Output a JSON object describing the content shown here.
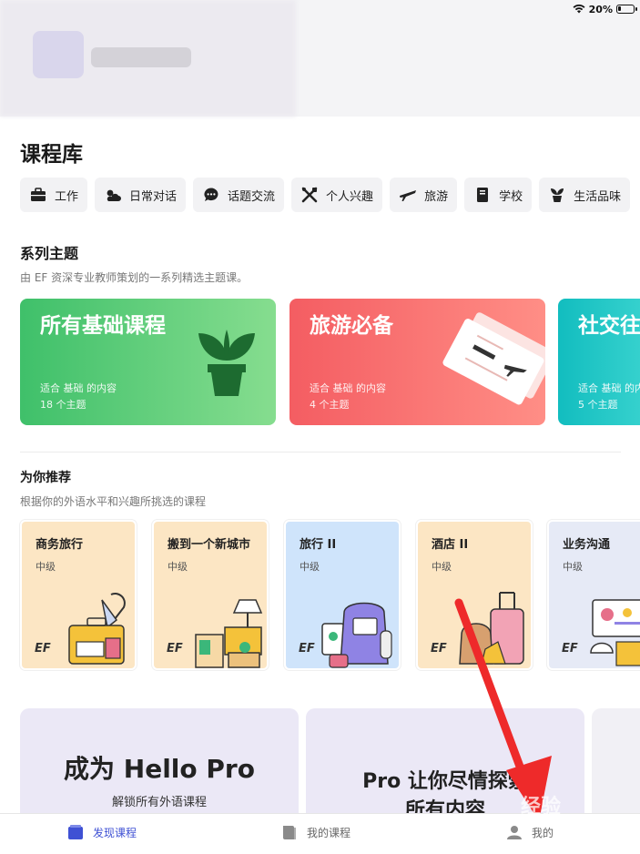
{
  "status": {
    "battery": "20%"
  },
  "library": {
    "title": "课程库",
    "categories": [
      {
        "label": "工作",
        "icon": "briefcase-icon"
      },
      {
        "label": "日常对话",
        "icon": "weather-icon"
      },
      {
        "label": "话题交流",
        "icon": "chat-icon"
      },
      {
        "label": "个人兴趣",
        "icon": "tools-icon"
      },
      {
        "label": "旅游",
        "icon": "airplane-icon"
      },
      {
        "label": "学校",
        "icon": "book-icon"
      },
      {
        "label": "生活品味",
        "icon": "plant-icon"
      }
    ]
  },
  "series": {
    "title": "系列主题",
    "subtitle": "由 EF 资深专业教师策划的一系列精选主题课。",
    "cards": [
      {
        "title": "所有基础课程",
        "meta1": "适合 基础 的内容",
        "meta2": "18 个主题",
        "color": "#3fc06a"
      },
      {
        "title": "旅游必备",
        "meta1": "适合 基础 的内容",
        "meta2": "4 个主题",
        "color": "#f45d62"
      },
      {
        "title": "社交往",
        "meta1": "适合 基础 的内容",
        "meta2": "5 个主题",
        "color": "#12bdbf"
      }
    ]
  },
  "recommend": {
    "title": "为你推荐",
    "subtitle": "根据你的外语水平和兴趣所挑选的课程",
    "cards": [
      {
        "title": "商务旅行",
        "level": "中级",
        "brand": "EF"
      },
      {
        "title": "搬到一个新城市",
        "level": "中级",
        "brand": "EF"
      },
      {
        "title": "旅行 II",
        "level": "中级",
        "brand": "EF"
      },
      {
        "title": "酒店 II",
        "level": "中级",
        "brand": "EF"
      },
      {
        "title": "业务沟通",
        "level": "中级",
        "brand": "EF"
      }
    ]
  },
  "promo": {
    "card1_title": "成为 Hello Pro",
    "card1_sub": "解锁所有外语课程",
    "card2_line1": "Pro 让你尽情探索",
    "card2_line2": "所有内容"
  },
  "tabs": [
    {
      "label": "发现课程",
      "active": true
    },
    {
      "label": "我的课程",
      "active": false
    },
    {
      "label": "我的",
      "active": false
    }
  ],
  "watermark": "经验"
}
